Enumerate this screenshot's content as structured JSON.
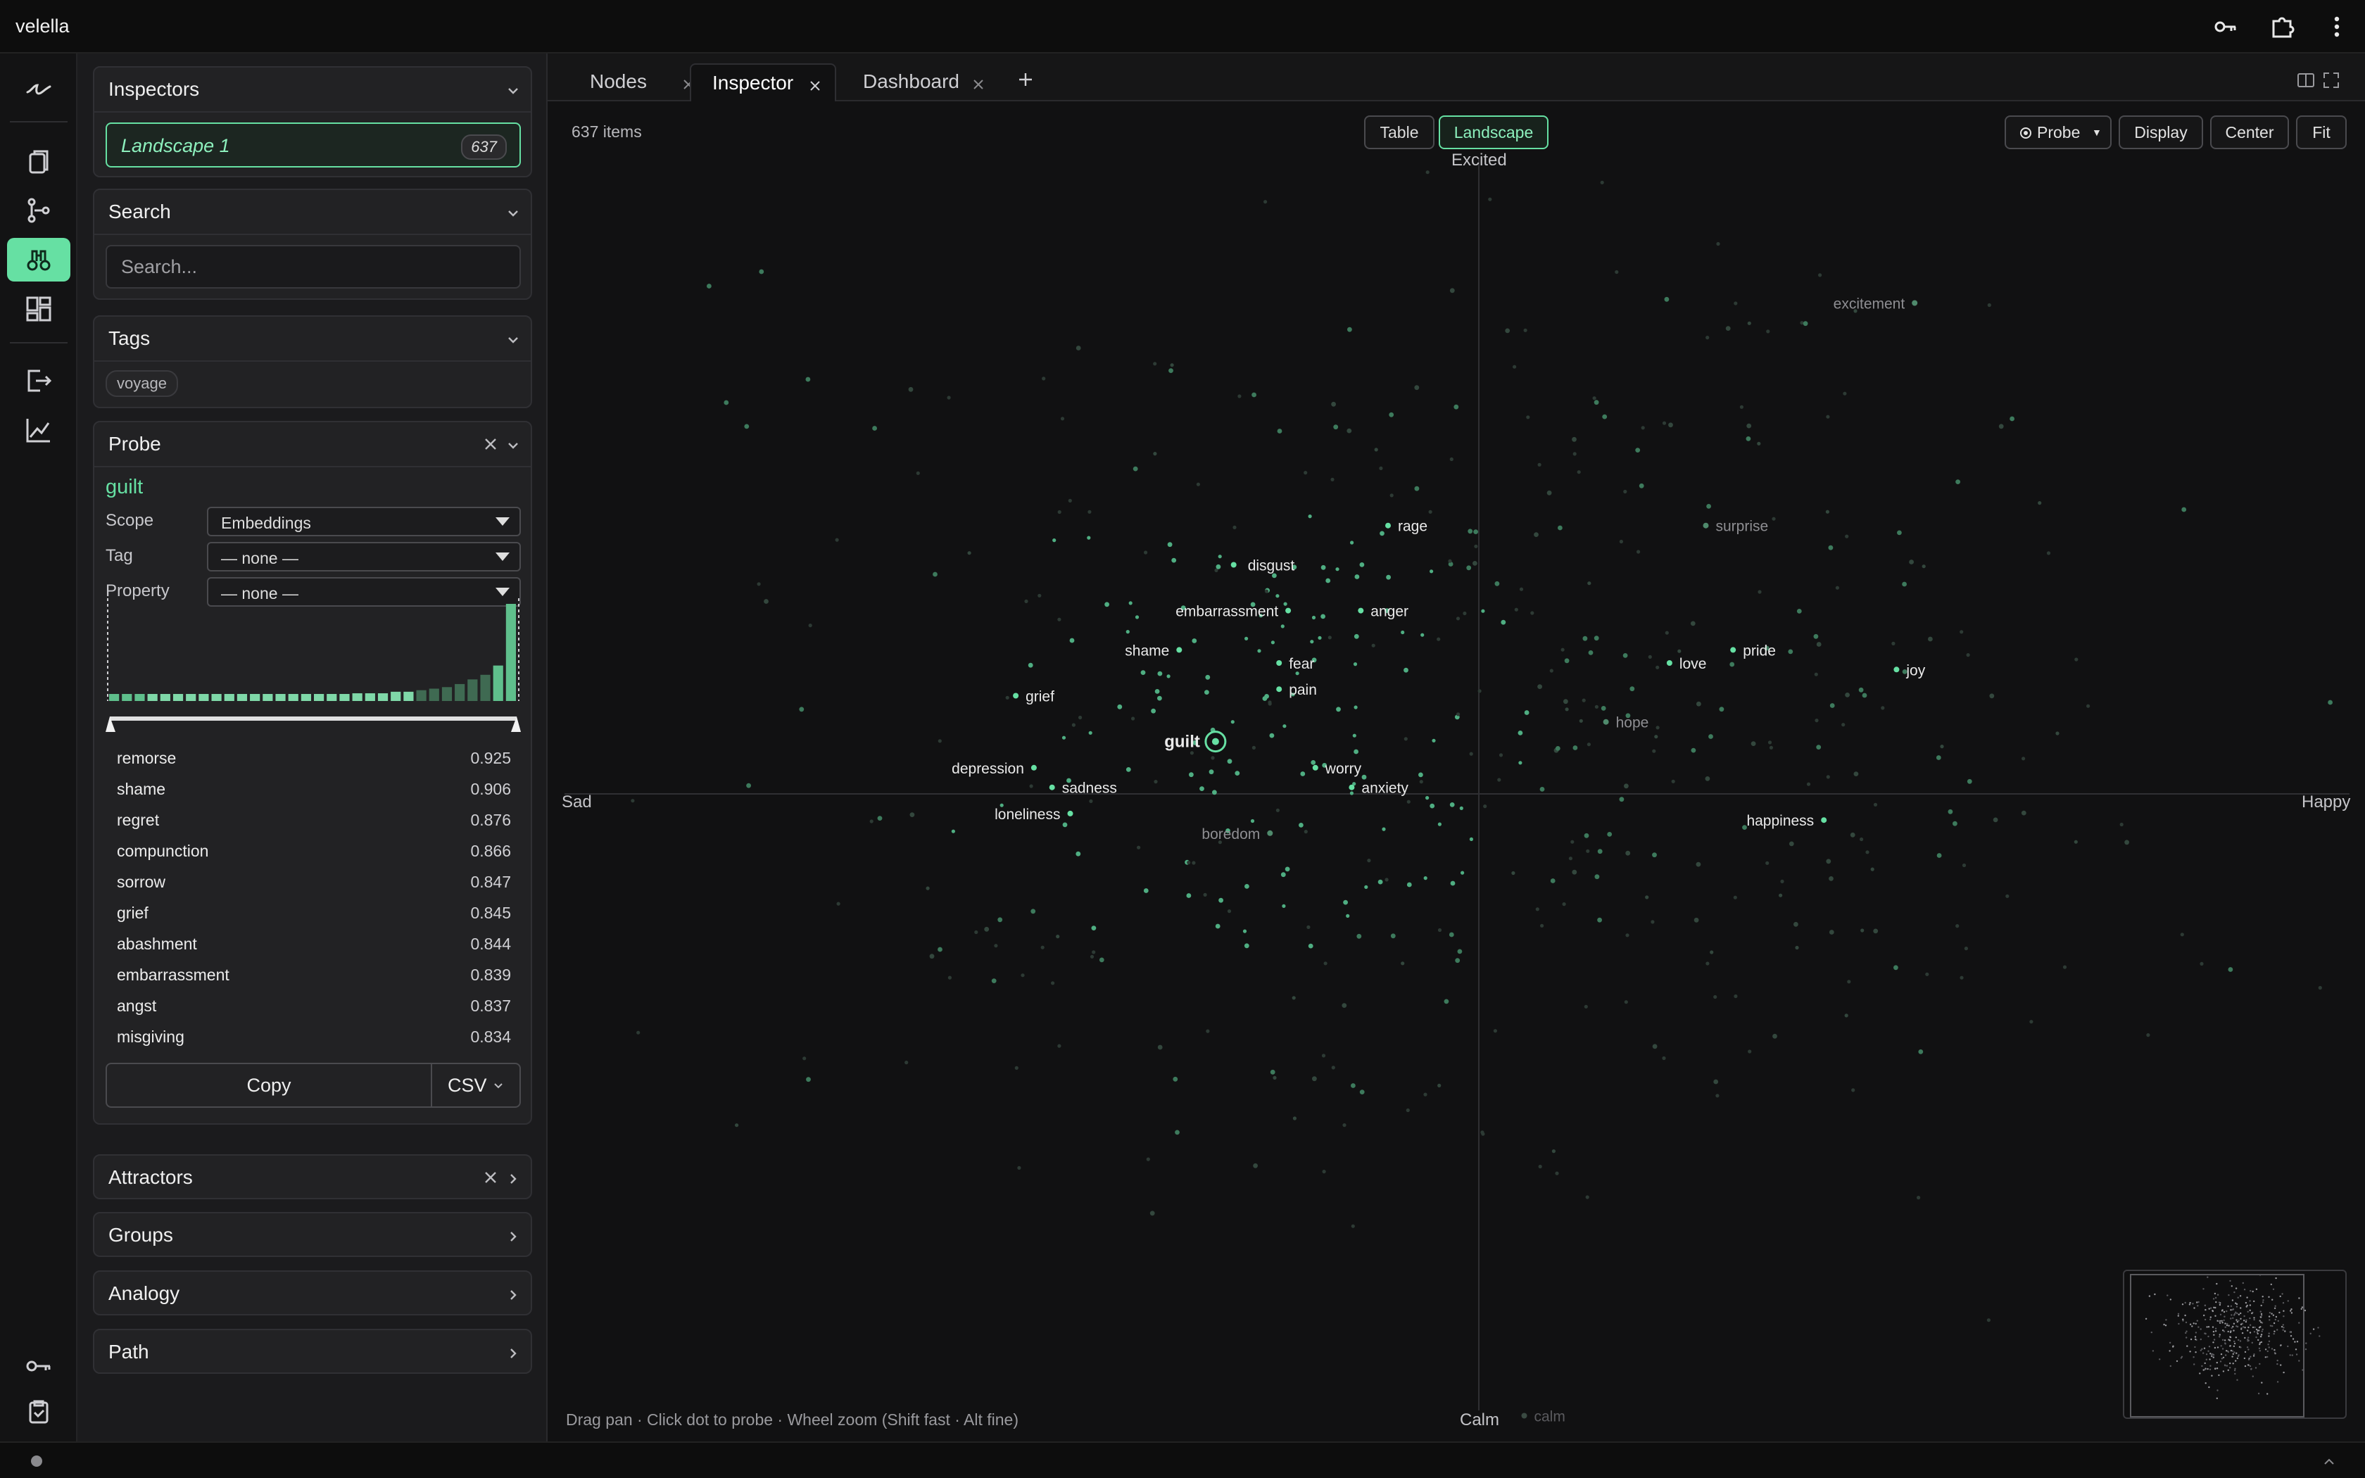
{
  "app": {
    "title": "velella"
  },
  "sidebar": {
    "inspectors": {
      "title": "Inspectors",
      "item_label": "Landscape 1",
      "item_count": "637"
    },
    "search": {
      "title": "Search",
      "placeholder": "Search..."
    },
    "tags": {
      "title": "Tags",
      "items": [
        "voyage"
      ]
    },
    "probe": {
      "title": "Probe",
      "word": "guilt",
      "scope_label": "Scope",
      "scope_value": "Embeddings",
      "tag_label": "Tag",
      "tag_value": "— none —",
      "property_label": "Property",
      "property_value": "— none —",
      "histogram": [
        2,
        2,
        2,
        2,
        2,
        2,
        2,
        2,
        2,
        2,
        3,
        3,
        3,
        3,
        3,
        3,
        4,
        4,
        4,
        5,
        5,
        5,
        6,
        6,
        7,
        8,
        9,
        11,
        14,
        17,
        23,
        63
      ],
      "range": [
        0,
        1
      ],
      "results": [
        {
          "word": "remorse",
          "score": "0.925"
        },
        {
          "word": "shame",
          "score": "0.906"
        },
        {
          "word": "regret",
          "score": "0.876"
        },
        {
          "word": "compunction",
          "score": "0.866"
        },
        {
          "word": "sorrow",
          "score": "0.847"
        },
        {
          "word": "grief",
          "score": "0.845"
        },
        {
          "word": "abashment",
          "score": "0.844"
        },
        {
          "word": "embarrassment",
          "score": "0.839"
        },
        {
          "word": "angst",
          "score": "0.837"
        },
        {
          "word": "misgiving",
          "score": "0.834"
        }
      ],
      "copy_label": "Copy",
      "format_label": "CSV"
    },
    "attractors": {
      "title": "Attractors"
    },
    "groups": {
      "title": "Groups"
    },
    "analogy": {
      "title": "Analogy"
    },
    "path": {
      "title": "Path"
    }
  },
  "tabs": [
    {
      "label": "Nodes"
    },
    {
      "label": "Inspector"
    },
    {
      "label": "Dashboard"
    }
  ],
  "view": {
    "item_count": "637 items",
    "mode_table": "Table",
    "mode_landscape": "Landscape",
    "probe_button": "Probe",
    "display_button": "Display",
    "center_button": "Center",
    "fit_button": "Fit",
    "axis_top": "Excited",
    "axis_bottom": "Calm",
    "axis_left": "Sad",
    "axis_right": "Happy",
    "hint": "Drag pan · Click dot to probe · Wheel zoom (Shift fast · Alt fine)"
  },
  "landscape_data": {
    "x_range": [
      -1,
      1
    ],
    "y_range": [
      -1,
      1
    ],
    "highlight_color": "#66e0a3",
    "probe_word": "guilt",
    "labeled_points": [
      {
        "word": "excitement",
        "x": 0.48,
        "y": 0.75,
        "tone": "dim"
      },
      {
        "word": "rage",
        "x": -0.1,
        "y": 0.41,
        "tone": "bright"
      },
      {
        "word": "surprise",
        "x": 0.25,
        "y": 0.41,
        "tone": "dim"
      },
      {
        "word": "disgust",
        "x": -0.27,
        "y": 0.35,
        "tone": "bright"
      },
      {
        "word": "embarrassment",
        "x": -0.21,
        "y": 0.28,
        "tone": "bright"
      },
      {
        "word": "anger",
        "x": -0.13,
        "y": 0.28,
        "tone": "bright"
      },
      {
        "word": "shame",
        "x": -0.33,
        "y": 0.22,
        "tone": "bright"
      },
      {
        "word": "fear",
        "x": -0.22,
        "y": 0.2,
        "tone": "bright"
      },
      {
        "word": "love",
        "x": 0.21,
        "y": 0.2,
        "tone": "bright"
      },
      {
        "word": "pride",
        "x": 0.28,
        "y": 0.22,
        "tone": "bright"
      },
      {
        "word": "joy",
        "x": 0.46,
        "y": 0.19,
        "tone": "bright"
      },
      {
        "word": "pain",
        "x": -0.22,
        "y": 0.16,
        "tone": "bright"
      },
      {
        "word": "grief",
        "x": -0.51,
        "y": 0.15,
        "tone": "bright"
      },
      {
        "word": "hope",
        "x": 0.14,
        "y": 0.11,
        "tone": "dim"
      },
      {
        "word": "guilt",
        "x": -0.29,
        "y": 0.08,
        "tone": "probe"
      },
      {
        "word": "worry",
        "x": -0.18,
        "y": 0.04,
        "tone": "bright"
      },
      {
        "word": "depression",
        "x": -0.49,
        "y": 0.04,
        "tone": "bright"
      },
      {
        "word": "anxiety",
        "x": -0.14,
        "y": 0.01,
        "tone": "bright"
      },
      {
        "word": "sadness",
        "x": -0.47,
        "y": 0.01,
        "tone": "bright"
      },
      {
        "word": "loneliness",
        "x": -0.45,
        "y": -0.03,
        "tone": "bright"
      },
      {
        "word": "happiness",
        "x": 0.38,
        "y": -0.04,
        "tone": "bright"
      },
      {
        "word": "boredom",
        "x": -0.23,
        "y": -0.06,
        "tone": "dim"
      },
      {
        "word": "calm",
        "x": 0.05,
        "y": -0.95,
        "tone": "faint"
      }
    ]
  }
}
